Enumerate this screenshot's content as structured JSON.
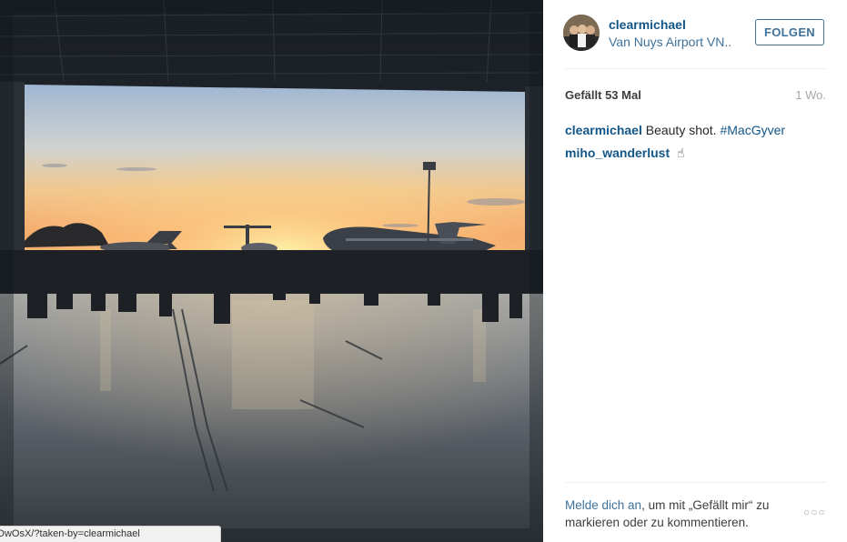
{
  "browser_status": {
    "url_fragment": "DwOsX/?taken-by=clearmichael"
  },
  "post": {
    "header": {
      "username": "clearmichael",
      "location": "Van Nuys Airport VN..",
      "follow_label": "FOLGEN"
    },
    "likes": "Gefällt 53 Mal",
    "age": "1 Wo.",
    "comments": [
      {
        "user": "clearmichael",
        "text": "Beauty shot.",
        "hashtag": "#MacGyver"
      },
      {
        "user": "miho_wanderlust",
        "emoji": "☝"
      }
    ],
    "login_prompt": {
      "link": "Melde dich an",
      "text": ", um mit „Gefällt mir“ zu markieren oder zu kommentieren."
    },
    "more_options": "○○○"
  },
  "icons": {
    "more": "more-options-icon",
    "emoji": "pointing-finger-emoji"
  },
  "colors": {
    "link_blue": "#125688",
    "button_blue": "#3f729b",
    "muted_gray": "#a5a7aa"
  }
}
